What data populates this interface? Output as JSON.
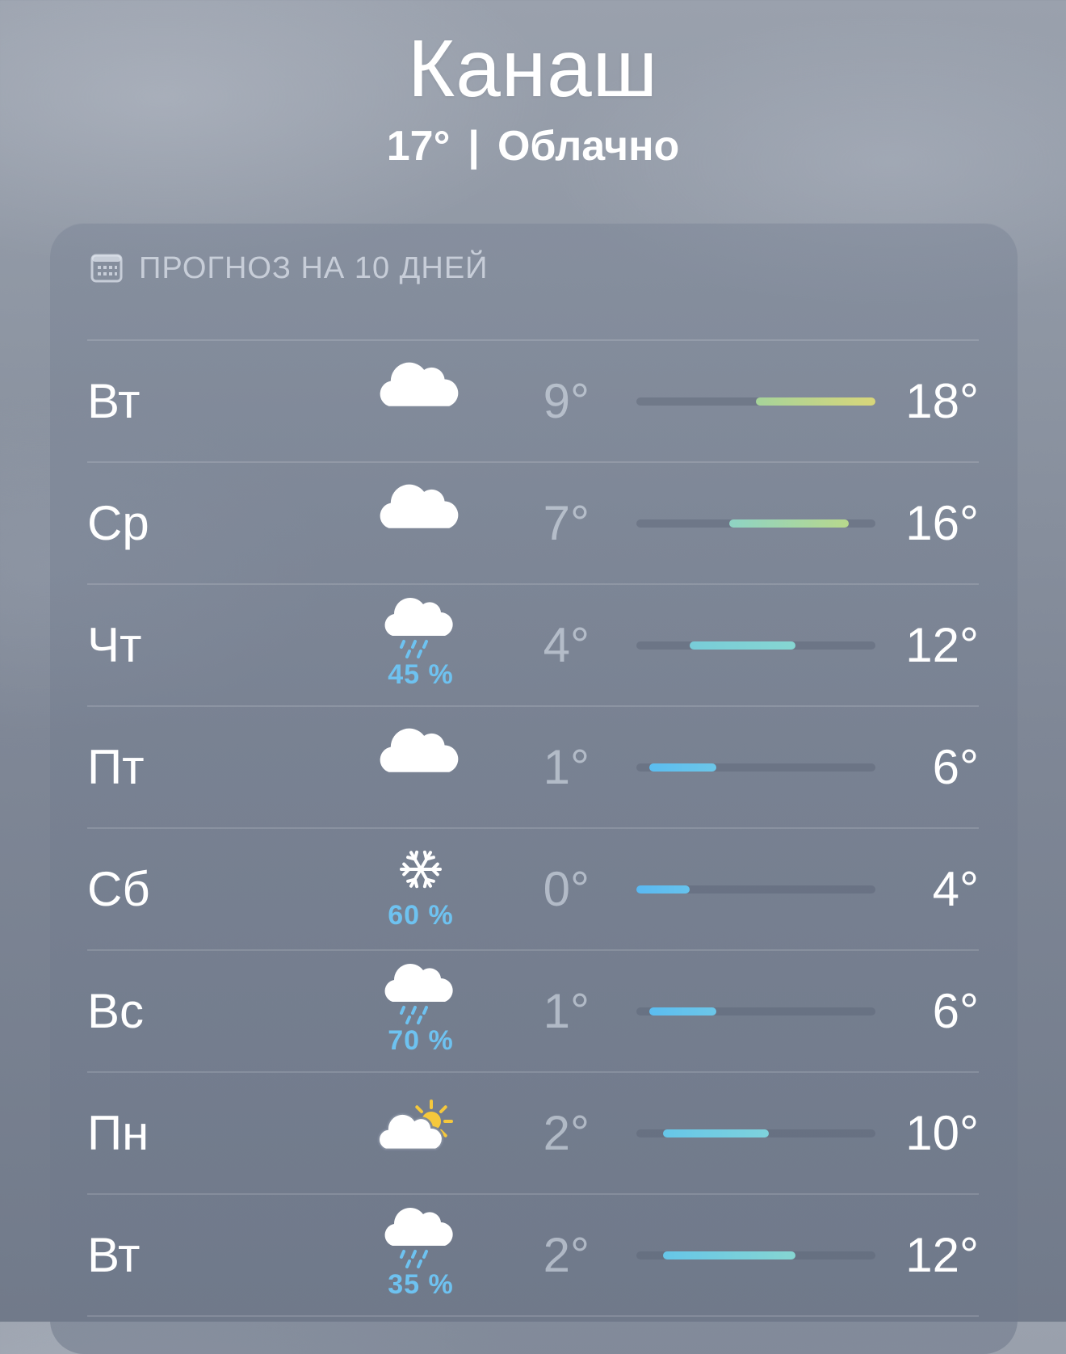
{
  "header": {
    "city": "Канаш",
    "temp": "17°",
    "separator": "|",
    "condition": "Облачно"
  },
  "forecast": {
    "title": "ПРОГНОЗ НА 10 ДНЕЙ",
    "title_icon": "calendar-icon",
    "range": {
      "min": 0,
      "max": 18
    },
    "days": [
      {
        "day": "Вт",
        "icon": "cloud-icon",
        "pop": "",
        "low": "9°",
        "high": "18°",
        "low_val": 9,
        "high_val": 18,
        "bar_colors": [
          "#a6d39a",
          "#d8d67a"
        ]
      },
      {
        "day": "Ср",
        "icon": "cloud-icon",
        "pop": "",
        "low": "7°",
        "high": "16°",
        "low_val": 7,
        "high_val": 16,
        "bar_colors": [
          "#8ed3c4",
          "#b8d88c"
        ]
      },
      {
        "day": "Чт",
        "icon": "cloud-rain-icon",
        "pop": "45 %",
        "low": "4°",
        "high": "12°",
        "low_val": 4,
        "high_val": 12,
        "bar_colors": [
          "#78ccd8",
          "#86d6d2"
        ]
      },
      {
        "day": "Пт",
        "icon": "cloud-icon",
        "pop": "",
        "low": "1°",
        "high": "6°",
        "low_val": 1,
        "high_val": 6,
        "bar_colors": [
          "#5bbdf0",
          "#6cc6e8"
        ]
      },
      {
        "day": "Сб",
        "icon": "snowflake-icon",
        "pop": "60 %",
        "low": "0°",
        "high": "4°",
        "low_val": 0,
        "high_val": 4,
        "bar_colors": [
          "#5ab9f2",
          "#66c2ec"
        ]
      },
      {
        "day": "Вс",
        "icon": "cloud-rain-icon",
        "pop": "70 %",
        "low": "1°",
        "high": "6°",
        "low_val": 1,
        "high_val": 6,
        "bar_colors": [
          "#5bbdf0",
          "#6cc6e8"
        ]
      },
      {
        "day": "Пн",
        "icon": "cloud-sun-icon",
        "pop": "",
        "low": "2°",
        "high": "10°",
        "low_val": 2,
        "high_val": 10,
        "bar_colors": [
          "#66c6e8",
          "#7ed2dc"
        ]
      },
      {
        "day": "Вт",
        "icon": "cloud-rain-icon",
        "pop": "35 %",
        "low": "2°",
        "high": "12°",
        "low_val": 2,
        "high_val": 12,
        "bar_colors": [
          "#66c6e8",
          "#86d6d2"
        ]
      }
    ]
  },
  "colors": {
    "pop_text": "#6ec2f0",
    "sun": "#f5c83c"
  }
}
